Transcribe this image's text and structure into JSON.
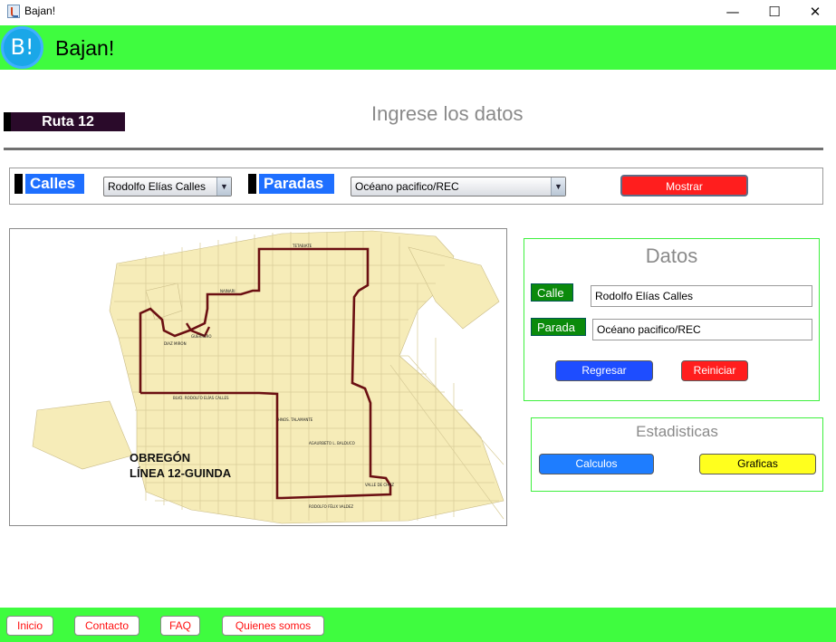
{
  "window": {
    "title": "Bajan!",
    "controls": {
      "minimize": "—",
      "maximize": "☐",
      "close": "✕"
    }
  },
  "header": {
    "logo_text": "B!",
    "app_name": "Bajan!"
  },
  "route": {
    "label": "Ruta 12"
  },
  "page": {
    "heading": "Ingrese los datos"
  },
  "filters": {
    "calles_label": "Calles",
    "calle_selected": "Rodolfo Elías Calles",
    "paradas_label": "Paradas",
    "parada_selected": "Océano pacifico/REC",
    "show_button": "Mostrar"
  },
  "map": {
    "title_line1": "OBREGÓN",
    "title_line2": "LÍNEA 12-GUINDA"
  },
  "datos": {
    "title": "Datos",
    "calle_label": "Calle",
    "calle_value": "Rodolfo Elías Calles",
    "parada_label": "Parada",
    "parada_value": "Océano pacifico/REC",
    "back_button": "Regresar",
    "reset_button": "Reiniciar"
  },
  "stats": {
    "title": "Estadisticas",
    "calc_button": "Calculos",
    "charts_button": "Graficas"
  },
  "footer": {
    "nav": [
      "Inicio",
      "Contacto",
      "FAQ",
      "Quienes somos"
    ]
  },
  "colors": {
    "brand_green": "#3ffc3f",
    "route_line": "#6b0f12",
    "map_blocks": "#f6ecb8",
    "danger": "#ff1e1e",
    "primary": "#1e4dff",
    "warning": "#ffff1e"
  }
}
